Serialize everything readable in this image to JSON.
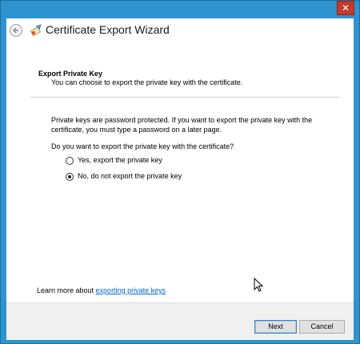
{
  "window": {
    "close_glyph": "✕"
  },
  "header": {
    "title": "Certificate Export Wizard",
    "back_icon": "back-arrow-icon",
    "wizard_icon": "certificate-icon"
  },
  "section": {
    "title": "Export Private Key",
    "subtitle": "You can choose to export the private key with the certificate."
  },
  "body": {
    "description": "Private keys are password protected. If you want to export the private key with the certificate, you must type a password on a later page.",
    "question": "Do you want to export the private key with the certificate?",
    "options": [
      {
        "label": "Yes, export the private key",
        "selected": false
      },
      {
        "label": "No, do not export the private key",
        "selected": true
      }
    ]
  },
  "learn_more": {
    "prefix": "Learn more about ",
    "link_text": "exporting private keys"
  },
  "footer": {
    "next_label": "Next",
    "cancel_label": "Cancel"
  },
  "colors": {
    "title_bar": "#2e93cf",
    "link": "#0066cc",
    "footer_bg": "#f0f0f0"
  }
}
